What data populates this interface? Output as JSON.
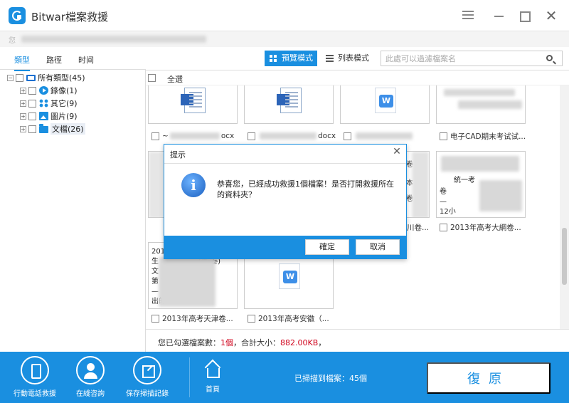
{
  "window": {
    "title": "Bitwar檔案救援",
    "subheader_text": "您          "
  },
  "left_tabs": [
    {
      "label": "類型",
      "active": true
    },
    {
      "label": "路徑",
      "active": false
    },
    {
      "label": "时间",
      "active": false
    }
  ],
  "tree": {
    "root": "所有類型(45)",
    "items": [
      {
        "label": "錄像(1)",
        "icon": "video-icon"
      },
      {
        "label": "其它(9)",
        "icon": "other-icon"
      },
      {
        "label": "圖片(9)",
        "icon": "image-icon"
      },
      {
        "label": "文檔(26)",
        "icon": "folder-icon"
      }
    ]
  },
  "toolbar": {
    "preview_mode": "預覽模式",
    "list_mode": "列表模式",
    "search_placeholder": "此處可以過濾檔案名"
  },
  "select_all": "全選",
  "files": {
    "row1": [
      {
        "name": "~",
        "suffix": "ocx"
      },
      {
        "name": "",
        "suffix": "docx"
      },
      {
        "name": "",
        "suffix": ""
      },
      {
        "name": "电子CAD期末考试试..."
      }
    ],
    "row2": [
      {
        "name": ""
      },
      {
        "name": ""
      },
      {
        "name": "",
        "suffix": "川卷..."
      },
      {
        "name": "2013年高考大綱卷..."
      }
    ],
    "row2_text": {
      "c4_line1": "統一考",
      "c4_line2": "卷",
      "c4_line3": "—",
      "c4_line4": "12小",
      "c3_a": "卷",
      "c3_b": "本",
      "c3_c": "卷"
    },
    "row3": [
      {
        "name": "2013年高考天津卷..."
      },
      {
        "name": "2013年高考安徽（..."
      }
    ],
    "row3_text": {
      "l1": "201",
      "l2": "生",
      "l3": "文",
      "l4": "第 1",
      "l5": "—",
      "l6": "出的",
      "l2b": "(土 卷)"
    }
  },
  "status": {
    "prefix": "您已勾選檔案數：",
    "count": "1個",
    "mid": "，合計大小：",
    "size": "882.00KB",
    "suffix": "，"
  },
  "bottom": {
    "mobile_rescue": "行動電話救援",
    "online_consult": "在綫咨詢",
    "save_scan": "保存掃描記錄",
    "home": "首頁",
    "scanned": "已掃描到檔案：45個",
    "recover": "復原"
  },
  "dialog": {
    "title": "提示",
    "message": "恭喜您，已經成功救援1個檔案！是否打開救援所在的資料夾？",
    "confirm": "確定",
    "cancel": "取消"
  },
  "colors": {
    "accent": "#1a8fe0",
    "size_red": "#d0021b"
  }
}
